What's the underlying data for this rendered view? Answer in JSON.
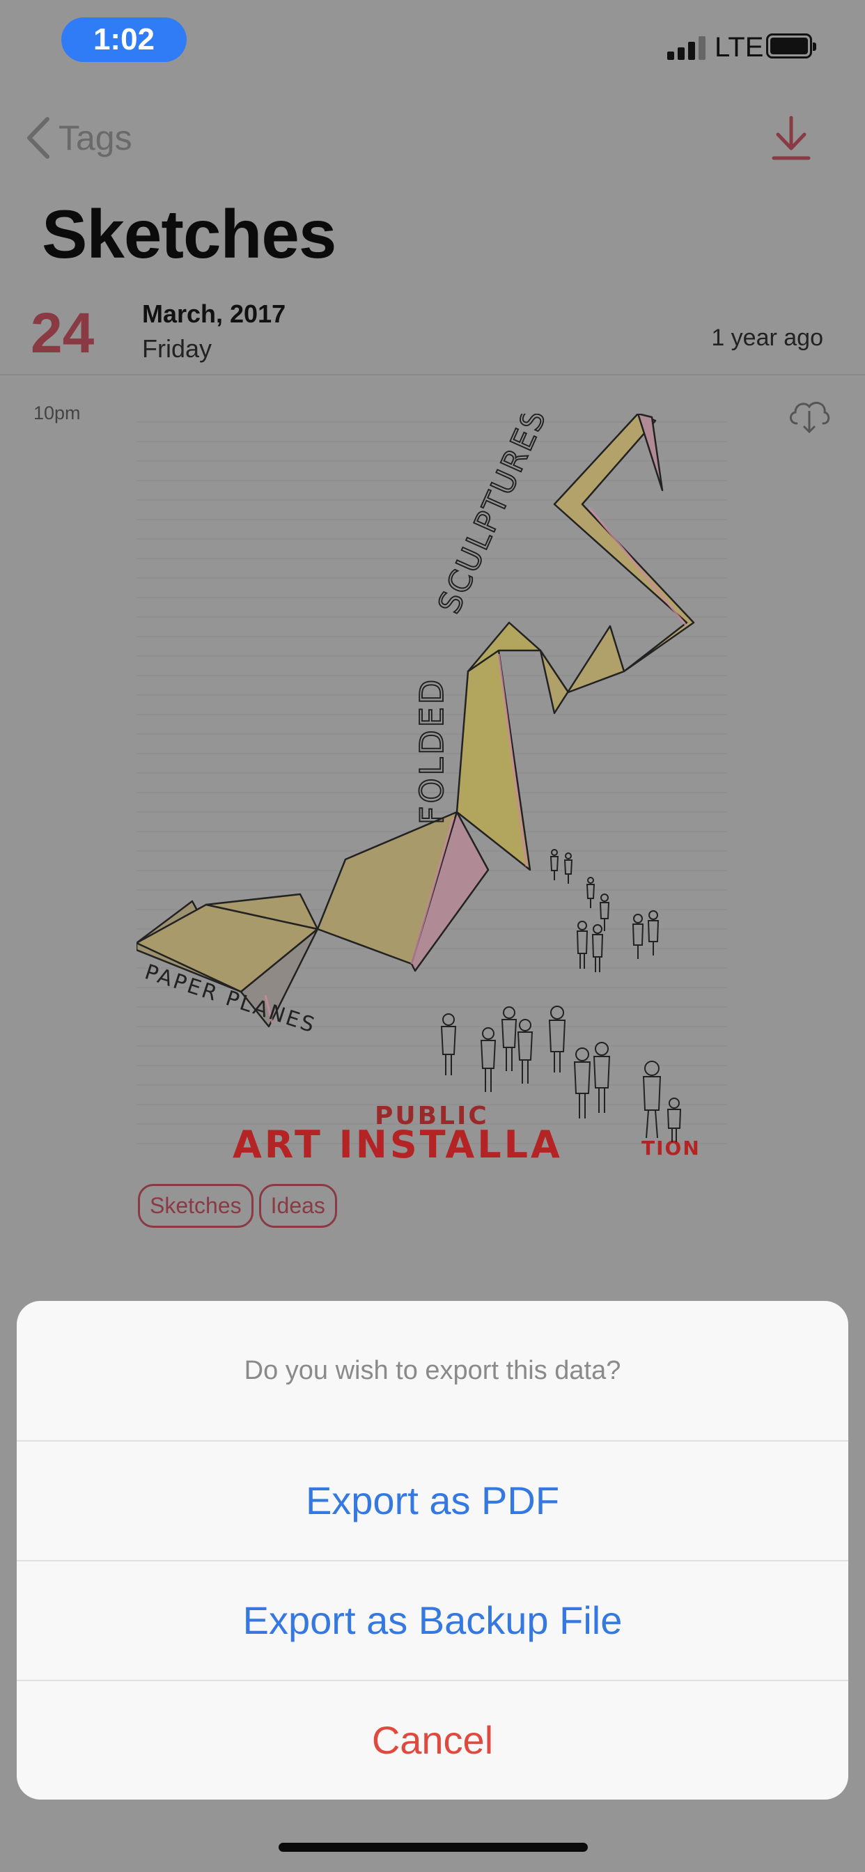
{
  "status_bar": {
    "time": "1:02",
    "network": "LTE"
  },
  "nav": {
    "back_label": "Tags",
    "download_icon": "download-icon"
  },
  "page": {
    "title": "Sketches"
  },
  "entry": {
    "day": "24",
    "month_year": "March, 2017",
    "weekday": "Friday",
    "relative": "1 year ago",
    "time": "10pm",
    "tags": [
      "Sketches",
      "Ideas"
    ],
    "sketch": {
      "text_folded": "FOLDED",
      "text_sculptures": "SCULPTURES",
      "text_paper_planes": "PAPER PLANES",
      "text_public": "PUBLIC",
      "text_art": "ART INSTALLA",
      "text_tion": "TION"
    }
  },
  "action_sheet": {
    "message": "Do you wish to export this data?",
    "export_pdf": "Export as PDF",
    "export_backup": "Export as Backup File",
    "cancel": "Cancel"
  },
  "colors": {
    "accent": "#8a3a43",
    "link": "#3478e0",
    "destructive": "#e0493f",
    "time_pill": "#2f7cf6"
  }
}
